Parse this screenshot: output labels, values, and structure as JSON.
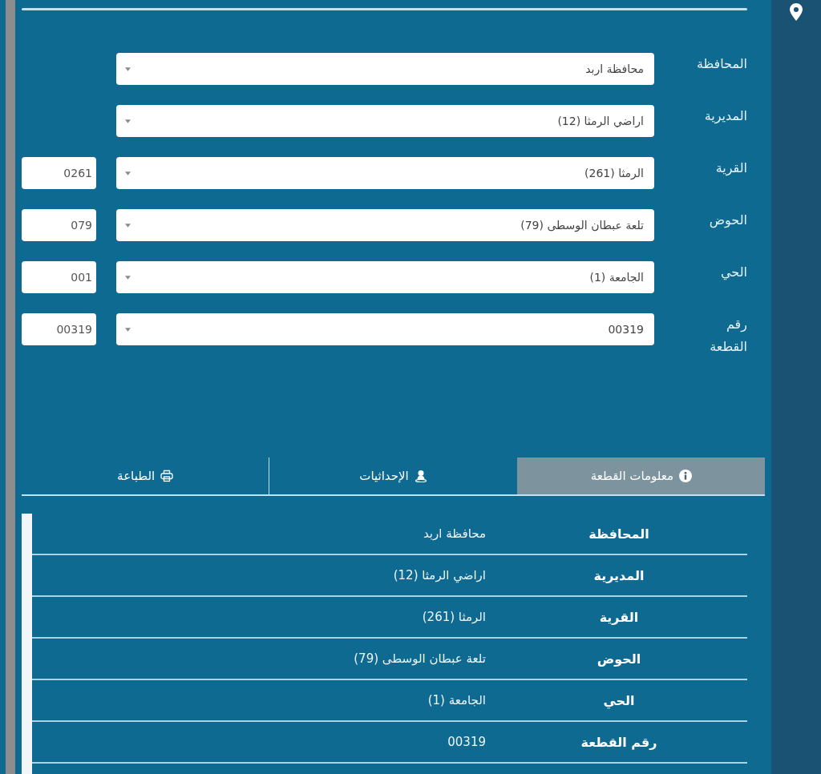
{
  "form": {
    "fields": [
      {
        "label": "المحافظة",
        "value": "محافظة اربد"
      },
      {
        "label": "المديرية",
        "value": "اراضي الرمثا (12)"
      },
      {
        "label": "القرية",
        "value": "الرمثا (261)",
        "code": "0261"
      },
      {
        "label": "الحوض",
        "value": "تلعة عبطان الوسطى (79)",
        "code": "079"
      },
      {
        "label": "الحي",
        "value": "الجامعة (1)",
        "code": "001"
      },
      {
        "label": "رقم القطعة",
        "value": "00319",
        "code": "00319"
      }
    ]
  },
  "tabs": [
    {
      "label": "معلومات القطعة",
      "selected": true
    },
    {
      "label": "الإحداثيات",
      "selected": false
    },
    {
      "label": "الطباعة",
      "selected": false
    }
  ],
  "info_table": {
    "rows": [
      {
        "label": "المحافظة",
        "value": "محافظة اربد"
      },
      {
        "label": "المديرية",
        "value": "اراضي الرمثا (12)"
      },
      {
        "label": "القرية",
        "value": "الرمثا (261)"
      },
      {
        "label": "الحوض",
        "value": "تلعة عبطان الوسطى (79)"
      },
      {
        "label": "الحي",
        "value": "الجامعة (1)"
      },
      {
        "label": "رقم القطعة",
        "value": "00319"
      }
    ]
  }
}
